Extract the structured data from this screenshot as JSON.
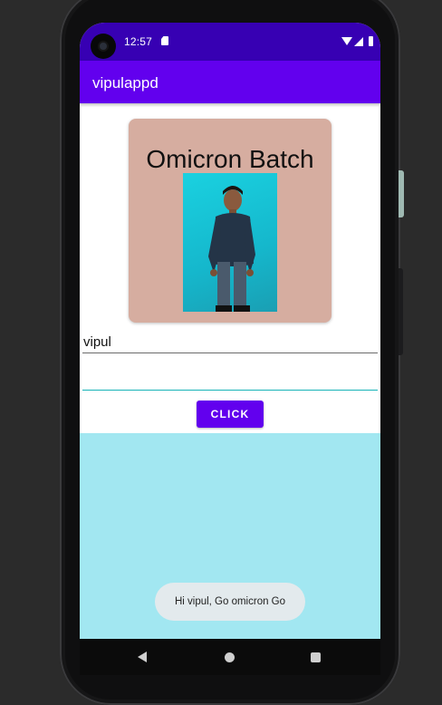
{
  "status_bar": {
    "time": "12:57"
  },
  "app_bar": {
    "title": "vipulappd"
  },
  "card": {
    "title": "Omicron Batch"
  },
  "name_field": {
    "value": "vipul"
  },
  "message_field": {
    "value": ""
  },
  "click_button": {
    "label": "CLICK"
  },
  "toast": {
    "text": "Hi vipul, Go omicron Go"
  },
  "colors": {
    "status_bar": "#3700b3",
    "app_bar": "#6200ee",
    "card_background": "#d6ada0",
    "bottom_area": "#a2e7f1",
    "field_underline_focused": "#17b3b8"
  },
  "icons": [
    "camera-icon",
    "sd-card-icon",
    "wifi-icon",
    "signal-icon",
    "battery-icon",
    "back-icon",
    "home-icon",
    "recents-icon"
  ]
}
